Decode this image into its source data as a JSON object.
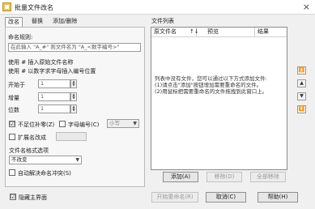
{
  "window": {
    "title": "批量文件改名",
    "close": "×"
  },
  "tabs": [
    {
      "label": "改名"
    },
    {
      "label": "替换"
    },
    {
      "label": "添加/删除"
    }
  ],
  "rename": {
    "rule_label": "命名规则:",
    "rule_placeholder": "在此输入 \"A_#\" 则文件名为 \"A_<数字编号>\"",
    "use_hash_text": "使用 # 插入原始文件名称",
    "use_hash2_text": "使用 # 以数字求字母插入编号位置",
    "start_label": "开始于",
    "start_value": "1",
    "step_label": "增量",
    "step_value": "1",
    "digits_label": "位数",
    "digits_value": "1",
    "fill_zero_label": "不足位补零(Z)",
    "fill_zero_checked": "☑",
    "letter_label": "字母编号(C)",
    "letter_checked": "",
    "case_value": "小写",
    "ext_label": "扩展名改成",
    "ext_checked": "",
    "case_opt_label": "文件名格式选项",
    "case_opt_value": "不改变",
    "autofix_label": "自动解决命名冲突(S)",
    "autofix_checked": ""
  },
  "file_list": {
    "group_title": "文件列表",
    "columns": [
      "原文件名",
      "↑↓",
      "预览",
      "结果"
    ],
    "hints": [
      "列表中没有文件，您可以通过以下方式添加文件:",
      "(1)请点击\"添加\"按钮增加需要重命名的文件。",
      "(2)用鼠标把需要重命名的文件拖拽到此窗口上。"
    ],
    "side_buttons": [
      "⏫",
      "▲",
      "▼",
      "⏬"
    ]
  },
  "buttons": {
    "add": "添加(A)",
    "remove": "移除(D)",
    "remove_all": "全部移除",
    "start": "开始重命名(R)",
    "cancel": "取消(C)",
    "help": "帮助(H)"
  },
  "footer": {
    "hide_label": "隐藏主界面",
    "hide_checked": "☑"
  }
}
